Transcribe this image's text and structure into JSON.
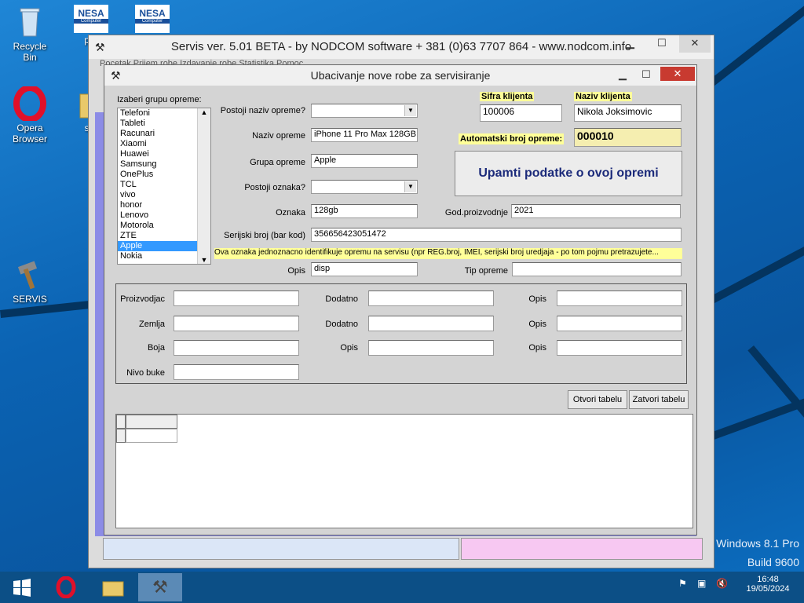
{
  "desktop": {
    "icons": [
      {
        "label": "Recycle Bin",
        "icon": "recycle-bin-icon"
      },
      {
        "label": "pro",
        "icon": "nesa-shortcut-icon",
        "badge": "NESA",
        "sub": "Computer"
      },
      {
        "label": "Opera Browser",
        "icon": "opera-icon"
      },
      {
        "label": "ser",
        "icon": "folder-icon"
      },
      {
        "label": "SERVIS",
        "icon": "hammer-icon"
      }
    ],
    "nesa2": {
      "badge": "NESA",
      "sub": "Computer"
    },
    "watermark_line1": "Windows 8.1 Pro",
    "watermark_line2": "Build 9600"
  },
  "main_window": {
    "title": "Servis ver. 5.01 BETA - by NODCOM software  + 381 (0)63 7707 864 - www.nodcom.info",
    "menu_text": "Pocetak  Prijem robe  Izdavanje robe  Statistika  Pomoc"
  },
  "dialog": {
    "title": "Ubacivanje nove robe za servisiranje",
    "group_label": "Izaberi grupu opreme:",
    "groups": [
      "Telefoni",
      "Tableti",
      "Racunari",
      "Xiaomi",
      "Huawei",
      "Samsung",
      "OnePlus",
      "TCL",
      "vivo",
      "honor",
      "Lenovo",
      "Motorola",
      "ZTE",
      "Apple",
      "Nokia"
    ],
    "selected_group": "Apple",
    "fields": {
      "postoji_naziv_label": "Postoji naziv opreme?",
      "postoji_naziv_value": "",
      "naziv_label": "Naziv opreme",
      "naziv_value": "iPhone 11 Pro Max 128GB",
      "grupa_label": "Grupa opreme",
      "grupa_value": "Apple",
      "postoji_oznaka_label": "Postoji oznaka?",
      "postoji_oznaka_value": "",
      "oznaka_label": "Oznaka",
      "oznaka_value": "128gb",
      "god_label": "God.proizvodnje",
      "god_value": "2021",
      "serijski_label": "Serijski broj (bar kod)",
      "serijski_value": "356656423051472",
      "hint": "Ova oznaka jednoznacno identifikuje opremu na servisu (npr REG.broj, IMEI, serijski broj uredjaja - po tom pojmu pretrazujete...",
      "opis_label": "Opis",
      "opis_value": "disp",
      "tip_label": "Tip opreme",
      "tip_value": ""
    },
    "client": {
      "sifra_label": "Sifra klijenta",
      "sifra_value": "100006",
      "naziv_label": "Naziv klijenta",
      "naziv_value": "Nikola Joksimovic",
      "auto_label": "Automatski broj opreme:",
      "auto_value": "000010"
    },
    "save_button": "Upamti podatke o ovoj opremi",
    "extra": {
      "proizvodjac_label": "Proizvodjac",
      "zemlja_label": "Zemlja",
      "boja_label": "Boja",
      "nivo_label": "Nivo buke",
      "dodatno1_label": "Dodatno",
      "dodatno2_label": "Dodatno",
      "opis_mid_label": "Opis",
      "opis_r1_label": "Opis",
      "opis_r2_label": "Opis",
      "opis_r3_label": "Opis"
    },
    "open_table": "Otvori tabelu",
    "close_table": "Zatvori tabelu"
  },
  "taskbar": {
    "time": "16:48",
    "date": "19/05/2024"
  },
  "colors": {
    "accent_label_bg": "#ffff99",
    "auto_bg": "#f5eeb0",
    "title_close": "#c83a30"
  }
}
